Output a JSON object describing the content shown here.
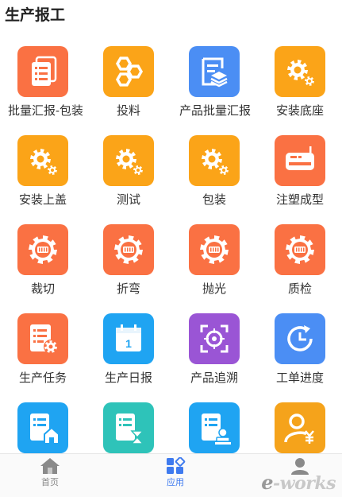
{
  "page_title": "生产报工",
  "colors": {
    "orange_red": "#FA7143",
    "orange": "#FBA418",
    "blue": "#4B8EF4",
    "sky": "#1FA4F2",
    "purple": "#9A55D5",
    "teal": "#2EC3B9",
    "yellow": "#F5A31B",
    "tab_active": "#3E7AEF",
    "tab_inactive": "#888888"
  },
  "apps": [
    {
      "label": "批量汇报-包装",
      "icon": "document-stack-icon",
      "color": "#FA7143"
    },
    {
      "label": "投料",
      "icon": "hexagons-icon",
      "color": "#FBA418"
    },
    {
      "label": "产品批量汇报",
      "icon": "layered-report-icon",
      "color": "#4B8EF4"
    },
    {
      "label": "安装底座",
      "icon": "gear-icon",
      "color": "#FBA418"
    },
    {
      "label": "安装上盖",
      "icon": "gear-icon",
      "color": "#FBA418"
    },
    {
      "label": "测试",
      "icon": "gear-icon",
      "color": "#FBA418"
    },
    {
      "label": "包装",
      "icon": "gear-icon",
      "color": "#FBA418"
    },
    {
      "label": "注塑成型",
      "icon": "printer-machine-icon",
      "color": "#FA7143"
    },
    {
      "label": "裁切",
      "icon": "cog-wheel-icon",
      "color": "#FA7143"
    },
    {
      "label": "折弯",
      "icon": "cog-wheel-icon",
      "color": "#FA7143"
    },
    {
      "label": "抛光",
      "icon": "cog-wheel-icon",
      "color": "#FA7143"
    },
    {
      "label": "质检",
      "icon": "cog-wheel-icon",
      "color": "#FA7143"
    },
    {
      "label": "生产任务",
      "icon": "task-list-gear-icon",
      "color": "#FA7143"
    },
    {
      "label": "生产日报",
      "icon": "calendar-icon",
      "color": "#1FA4F2",
      "calendar_day": "1"
    },
    {
      "label": "产品追溯",
      "icon": "target-trace-icon",
      "color": "#9A55D5"
    },
    {
      "label": "工单进度",
      "icon": "clock-progress-icon",
      "color": "#4B8EF4"
    },
    {
      "label": "",
      "icon": "list-home-icon",
      "color": "#1FA4F2"
    },
    {
      "label": "",
      "icon": "list-hourglass-icon",
      "color": "#2EC3B9"
    },
    {
      "label": "",
      "icon": "list-stamp-icon",
      "color": "#1FA4F2"
    },
    {
      "label": "",
      "icon": "user-yen-icon",
      "color": "#F5A31B"
    }
  ],
  "tabbar": {
    "home_label": "首页",
    "apps_label": "应用"
  },
  "watermark": "e-works"
}
